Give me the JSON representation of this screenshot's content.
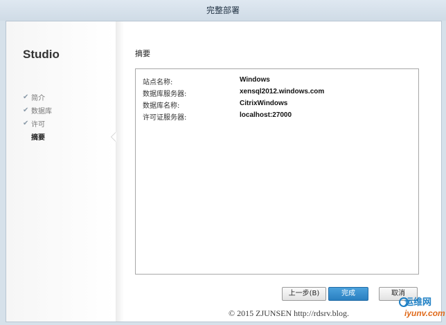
{
  "window": {
    "title": "完整部署"
  },
  "sidebar": {
    "brand": "Studio",
    "steps": [
      {
        "label": "简介",
        "done": true
      },
      {
        "label": "数据库",
        "done": true
      },
      {
        "label": "许可",
        "done": true
      },
      {
        "label": "摘要",
        "done": false,
        "active": true
      }
    ],
    "check_glyph": "✔"
  },
  "content": {
    "title": "摘要",
    "summary": [
      {
        "label": "站点名称:",
        "value": "Windows"
      },
      {
        "label": "数据库服务器:",
        "value": "xensql2012.windows.com"
      },
      {
        "label": "数据库名称:",
        "value": "CitrixWindows"
      },
      {
        "label": "许可证服务器:",
        "value": "localhost:27000"
      }
    ]
  },
  "buttons": {
    "back": "上一步(B)",
    "finish": "完成",
    "cancel": "取消"
  },
  "watermark": {
    "text": "© 2015 ZJUNSEN http://rdsrv.blog."
  },
  "logo": {
    "cn": "运维网",
    "en": "iyunv.com"
  },
  "colors": {
    "accent": "#2a7fc0",
    "window_bg": "#d6e1ea"
  }
}
